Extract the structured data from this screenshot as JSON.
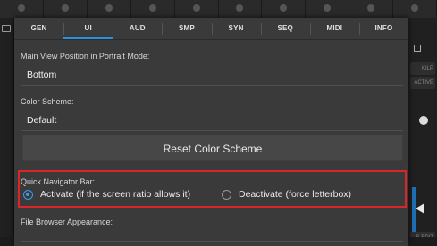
{
  "tabs": [
    {
      "label": "GEN"
    },
    {
      "label": "UI"
    },
    {
      "label": "AUD"
    },
    {
      "label": "SMP"
    },
    {
      "label": "SYN"
    },
    {
      "label": "SEQ"
    },
    {
      "label": "MIDI"
    },
    {
      "label": "INFO"
    }
  ],
  "active_tab": "UI",
  "settings": {
    "main_view_position": {
      "label": "Main View Position in Portrait Mode:",
      "value": "Bottom"
    },
    "color_scheme": {
      "label": "Color Scheme:",
      "value": "Default",
      "reset_label": "Reset Color Scheme"
    },
    "quick_navigator": {
      "label": "Quick Navigator Bar:",
      "options": [
        {
          "label": "Activate (if the screen ratio allows it)",
          "selected": true
        },
        {
          "label": "Deactivate (force letterbox)",
          "selected": false
        }
      ]
    },
    "file_browser": {
      "label": "File Browser Appearance:"
    }
  },
  "background": {
    "right_buttons": [
      "KILP",
      "ACTIVE",
      "S-EDIT"
    ]
  },
  "colors": {
    "accent": "#2d8fe0",
    "highlight": "#d9262b"
  }
}
